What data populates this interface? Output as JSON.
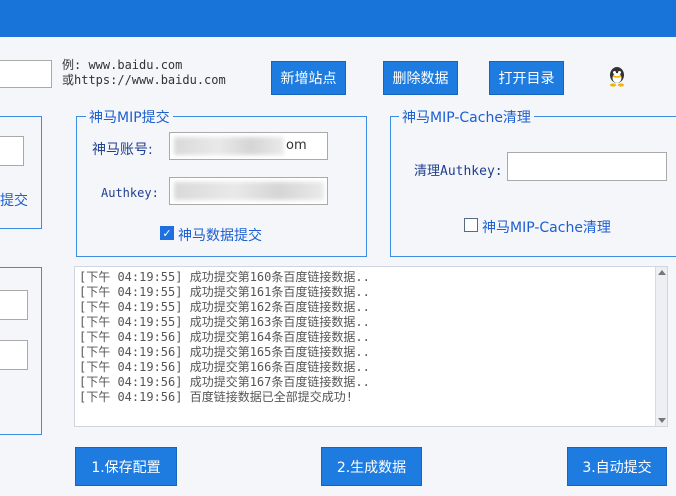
{
  "titlebar": {
    "color": "#1874d8"
  },
  "top": {
    "example_line1": "例: www.baidu.com",
    "example_line2": "或https://www.baidu.com",
    "add_site_button": "新增站点",
    "delete_data_button": "删除数据",
    "open_dir_button": "打开目录",
    "qq_icon": "penguin-icon"
  },
  "left_partial": {
    "submit_fragment": "提交"
  },
  "mip_group": {
    "legend": "神马MIP提交",
    "account_label": "神马账号:",
    "account_value_suffix": "om",
    "authkey_label": "Authkey:",
    "checkbox_label": "神马数据提交",
    "checkbox_checked": true
  },
  "cache_group": {
    "legend": "神马MIP-Cache清理",
    "authkey_label": "清理Authkey:",
    "authkey_value": "",
    "checkbox_label": "神马MIP-Cache清理",
    "checkbox_checked": false
  },
  "log": {
    "lines": [
      "[下午 04:19:55] 成功提交第160条百度链接数据..",
      "[下午 04:19:55] 成功提交第161条百度链接数据..",
      "[下午 04:19:55] 成功提交第162条百度链接数据..",
      "[下午 04:19:55] 成功提交第163条百度链接数据..",
      "[下午 04:19:56] 成功提交第164条百度链接数据..",
      "[下午 04:19:56] 成功提交第165条百度链接数据..",
      "[下午 04:19:56] 成功提交第166条百度链接数据..",
      "[下午 04:19:56] 成功提交第167条百度链接数据..",
      "[下午 04:19:56] 百度链接数据已全部提交成功!"
    ]
  },
  "bottom": {
    "save_config_button": "1.保存配置",
    "generate_data_button": "2.生成数据",
    "auto_submit_button": "3.自动提交"
  }
}
